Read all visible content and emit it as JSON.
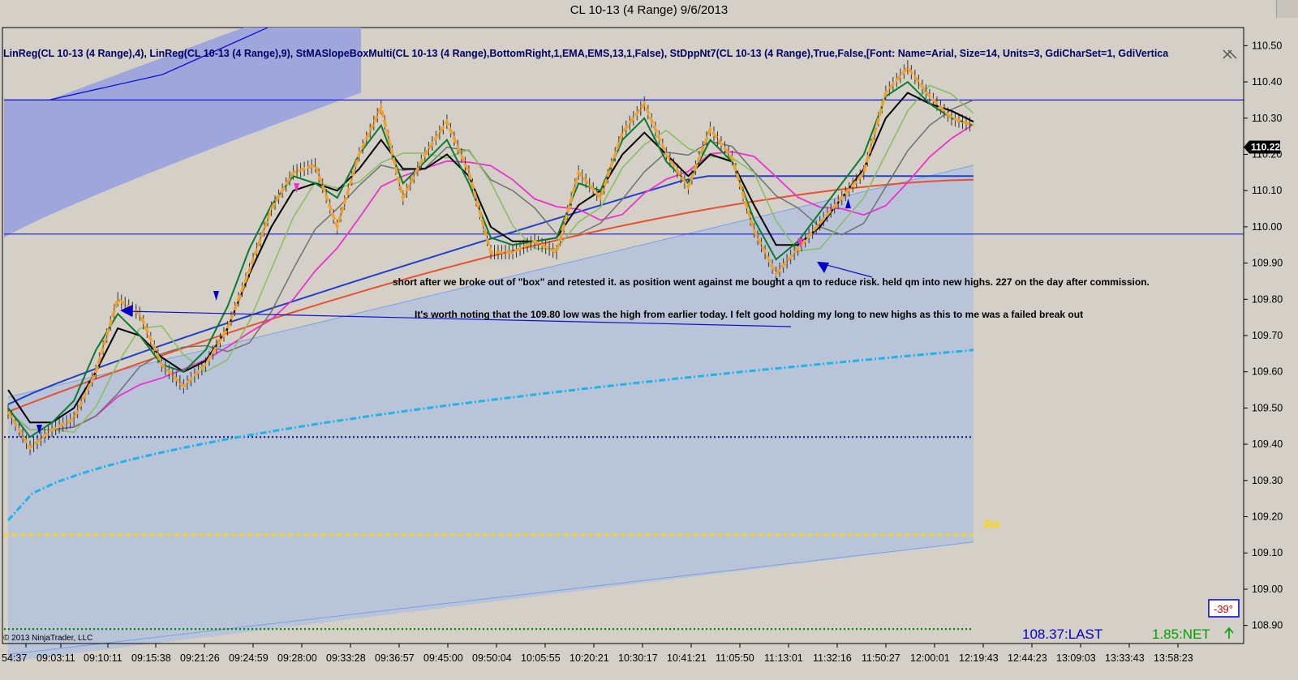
{
  "window": {
    "title": "CL 10-13 (4 Range)  9/6/2013"
  },
  "indicator_label": "LinReg(CL 10-13 (4 Range),4), LinReg(CL 10-13 (4 Range),9), StMASlopeBoxMulti(CL 10-13 (4 Range),BottomRight,1,EMA,EMS,13,1,False), StDppNt7(CL 10-13 (4 Range),True,False,[Font: Name=Arial, Size=14, Units=3, GdiCharSet=1, GdiVertica",
  "copyright": "© 2013 NinjaTrader, LLC",
  "status": {
    "last": "108.37:LAST",
    "net": "1.85:NET",
    "angle": "-39°",
    "r4_label": "R4",
    "current_price": "110.22"
  },
  "annotations": [
    "short after we broke out of \"box\" and retested it.  as position went against me bought a qm to reduce risk.  held qm into new highs. 227 on the day after commission.",
    "It's worth noting that the 109.80 low was the high from earlier today.  I felt good holding my long to new highs as this to me was a failed break out"
  ],
  "colors": {
    "background": "#d4d0c8",
    "box_fill": "#9ea6dc",
    "band_fill": "#b9c4d8",
    "price": "#f0a030",
    "accent_blue": "#0000cc"
  },
  "chart_data": {
    "type": "line",
    "title": "CL 10-13 (4 Range)  9/6/2013",
    "ylim": [
      108.85,
      110.55
    ],
    "yticks": [
      "110.50",
      "110.40",
      "110.30",
      "110.20",
      "110.10",
      "110.00",
      "109.90",
      "109.80",
      "109.70",
      "109.60",
      "109.50",
      "109.40",
      "109.30",
      "109.20",
      "109.10",
      "109.00",
      "108.90"
    ],
    "xticks": [
      "54:37",
      "09:03:11",
      "09:10:11",
      "09:15:38",
      "09:21:26",
      "09:24:59",
      "09:28:00",
      "09:33:28",
      "09:36:57",
      "09:45:00",
      "09:50:04",
      "10:05:55",
      "10:20:21",
      "10:30:17",
      "10:41:21",
      "11:05:50",
      "11:13:01",
      "11:32:16",
      "11:50:27",
      "12:00:01",
      "12:19:43",
      "12:44:23",
      "13:09:03",
      "13:33:43",
      "13:58:23"
    ],
    "price_path": [
      [
        0,
        109.49
      ],
      [
        1,
        109.39
      ],
      [
        2,
        109.44
      ],
      [
        3,
        109.47
      ],
      [
        4,
        109.6
      ],
      [
        5,
        109.8
      ],
      [
        6,
        109.76
      ],
      [
        7,
        109.62
      ],
      [
        8,
        109.56
      ],
      [
        9,
        109.62
      ],
      [
        10,
        109.72
      ],
      [
        11,
        109.88
      ],
      [
        12,
        110.05
      ],
      [
        13,
        110.15
      ],
      [
        14,
        110.17
      ],
      [
        15,
        110.0
      ],
      [
        16,
        110.2
      ],
      [
        17,
        110.33
      ],
      [
        18,
        110.08
      ],
      [
        19,
        110.2
      ],
      [
        20,
        110.29
      ],
      [
        21,
        110.15
      ],
      [
        22,
        109.93
      ],
      [
        23,
        109.93
      ],
      [
        24,
        109.96
      ],
      [
        25,
        109.93
      ],
      [
        26,
        110.15
      ],
      [
        27,
        110.08
      ],
      [
        28,
        110.26
      ],
      [
        29,
        110.34
      ],
      [
        30,
        110.2
      ],
      [
        31,
        110.11
      ],
      [
        32,
        110.27
      ],
      [
        33,
        110.19
      ],
      [
        34,
        109.99
      ],
      [
        35,
        109.87
      ],
      [
        36,
        109.94
      ],
      [
        37,
        110.01
      ],
      [
        38,
        110.08
      ],
      [
        39,
        110.15
      ],
      [
        40,
        110.37
      ],
      [
        41,
        110.44
      ],
      [
        42,
        110.36
      ],
      [
        43,
        110.3
      ],
      [
        44,
        110.28
      ]
    ],
    "series": [
      {
        "name": "LinReg(CL 10-13 (4 Range),4)",
        "values": [
          109.5,
          109.42,
          109.46,
          109.52,
          109.66,
          109.76,
          109.7,
          109.62,
          109.6,
          109.66,
          109.78,
          109.94,
          110.06,
          110.14,
          110.12,
          110.08,
          110.2,
          110.28,
          110.12,
          110.18,
          110.24,
          110.12,
          109.97,
          109.95,
          109.96,
          109.97,
          110.12,
          110.1,
          110.24,
          110.3,
          110.18,
          110.12,
          110.24,
          110.18,
          110.02,
          109.91,
          109.96,
          110.04,
          110.12,
          110.2,
          110.36,
          110.4,
          110.34,
          110.3,
          110.28
        ]
      },
      {
        "name": "LinReg(CL 10-13 (4 Range),9)",
        "values": [
          109.55,
          109.46,
          109.46,
          109.5,
          109.6,
          109.72,
          109.7,
          109.64,
          109.6,
          109.63,
          109.72,
          109.87,
          110.0,
          110.1,
          110.12,
          110.1,
          110.16,
          110.24,
          110.16,
          110.16,
          110.2,
          110.14,
          110.0,
          109.96,
          109.96,
          109.97,
          110.06,
          110.1,
          110.2,
          110.26,
          110.2,
          110.14,
          110.2,
          110.18,
          110.06,
          109.95,
          109.95,
          110.0,
          110.08,
          110.16,
          110.3,
          110.37,
          110.34,
          110.32,
          110.29
        ]
      }
    ],
    "levels": [
      {
        "name": "box-top",
        "value": 110.35
      },
      {
        "name": "box-bottom",
        "value": 109.98
      },
      {
        "name": "pivot-dotted",
        "value": 109.42
      },
      {
        "name": "R4",
        "value": 109.15
      },
      {
        "name": "green-dotted",
        "value": 108.89
      }
    ]
  }
}
